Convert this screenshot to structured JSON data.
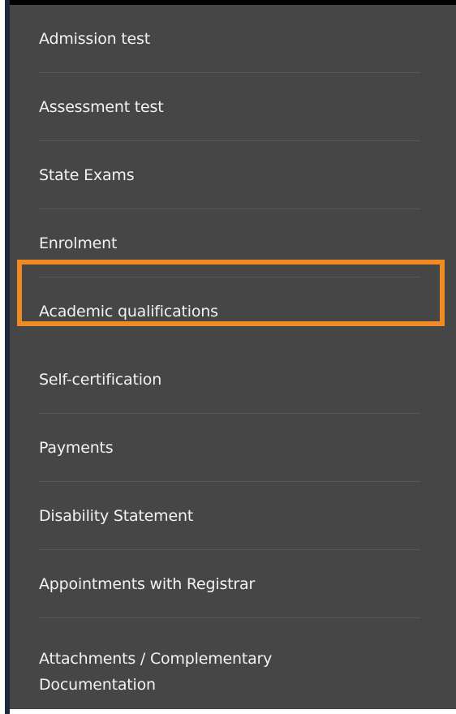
{
  "menu": {
    "items": [
      {
        "label": "Admission test"
      },
      {
        "label": "Assessment test"
      },
      {
        "label": "State Exams"
      },
      {
        "label": "Enrolment"
      },
      {
        "label": "Academic qualifications",
        "highlighted": true
      },
      {
        "label": "Self-certification"
      },
      {
        "label": "Payments"
      },
      {
        "label": "Disability Statement"
      },
      {
        "label": "Appointments with Registrar"
      },
      {
        "label_line1": "Attachments / Complementary",
        "label_line2": "Documentation"
      }
    ]
  },
  "colors": {
    "panel_background": "#464646",
    "text": "#f2f2f2",
    "divider": "#585858",
    "highlight": "#f08a24"
  }
}
